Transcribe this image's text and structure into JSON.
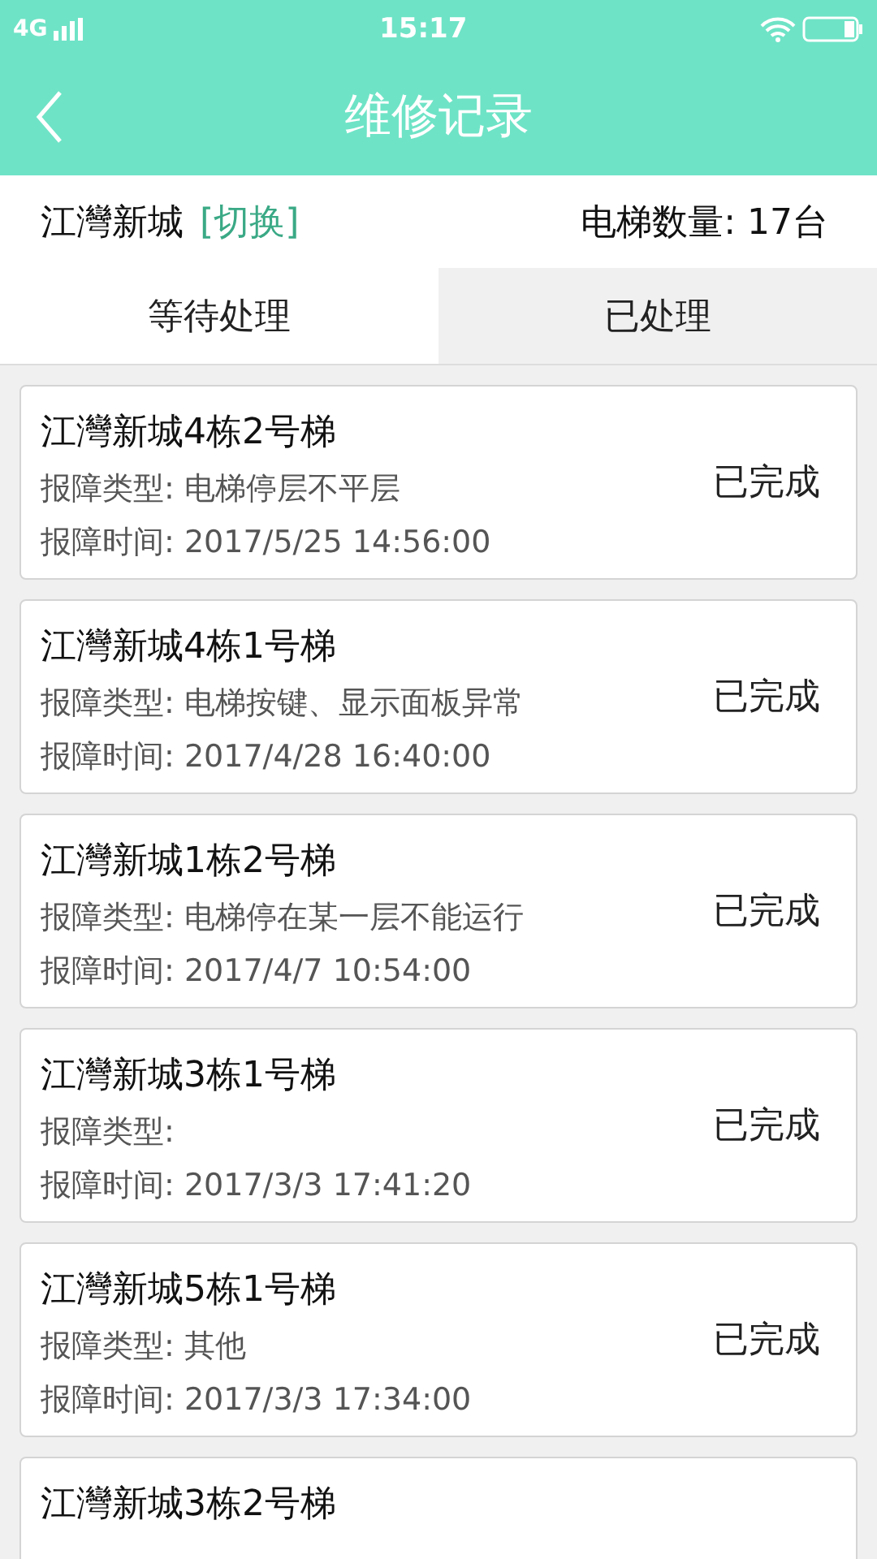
{
  "status_bar": {
    "network": "4G",
    "time": "15:17"
  },
  "header": {
    "title": "维修记录"
  },
  "info": {
    "community": "江灣新城",
    "switch": "[切换]",
    "count": "电梯数量: 17台"
  },
  "tabs": [
    {
      "label": "等待处理",
      "selected": false
    },
    {
      "label": "已处理",
      "selected": true
    }
  ],
  "records": [
    {
      "title": "江灣新城4栋2号梯",
      "type": "报障类型: 电梯停层不平层",
      "time": "报障时间: 2017/5/25 14:56:00",
      "status": "已完成"
    },
    {
      "title": "江灣新城4栋1号梯",
      "type": "报障类型: 电梯按键、显示面板异常",
      "time": "报障时间: 2017/4/28 16:40:00",
      "status": "已完成"
    },
    {
      "title": "江灣新城1栋2号梯",
      "type": "报障类型: 电梯停在某一层不能运行",
      "time": "报障时间: 2017/4/7 10:54:00",
      "status": "已完成"
    },
    {
      "title": "江灣新城3栋1号梯",
      "type": "报障类型:",
      "time": "报障时间: 2017/3/3 17:41:20",
      "status": "已完成"
    },
    {
      "title": "江灣新城5栋1号梯",
      "type": "报障类型: 其他",
      "time": "报障时间: 2017/3/3 17:34:00",
      "status": "已完成"
    },
    {
      "title": "江灣新城3栋2号梯"
    }
  ]
}
